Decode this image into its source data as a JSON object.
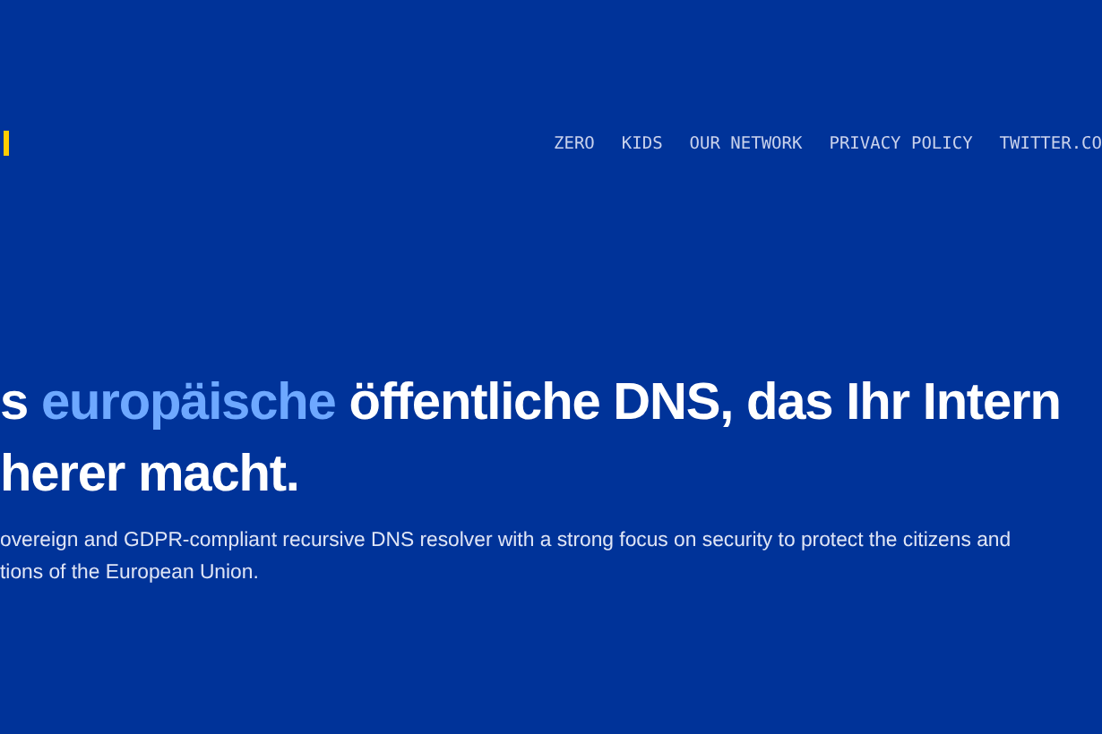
{
  "nav": {
    "links": [
      "ZERO",
      "KIDS",
      "OUR NETWORK",
      "PRIVACY POLICY",
      "TWITTER.CO"
    ]
  },
  "headline": {
    "lead": "s ",
    "highlight": "europäische",
    "rest": " öffentliche DNS, das Ihr Intern",
    "line_2": "herer macht."
  },
  "description": [
    "overeign and GDPR-compliant recursive DNS resolver with a strong focus on security to protect the citizens and",
    "tions of the European Union."
  ]
}
